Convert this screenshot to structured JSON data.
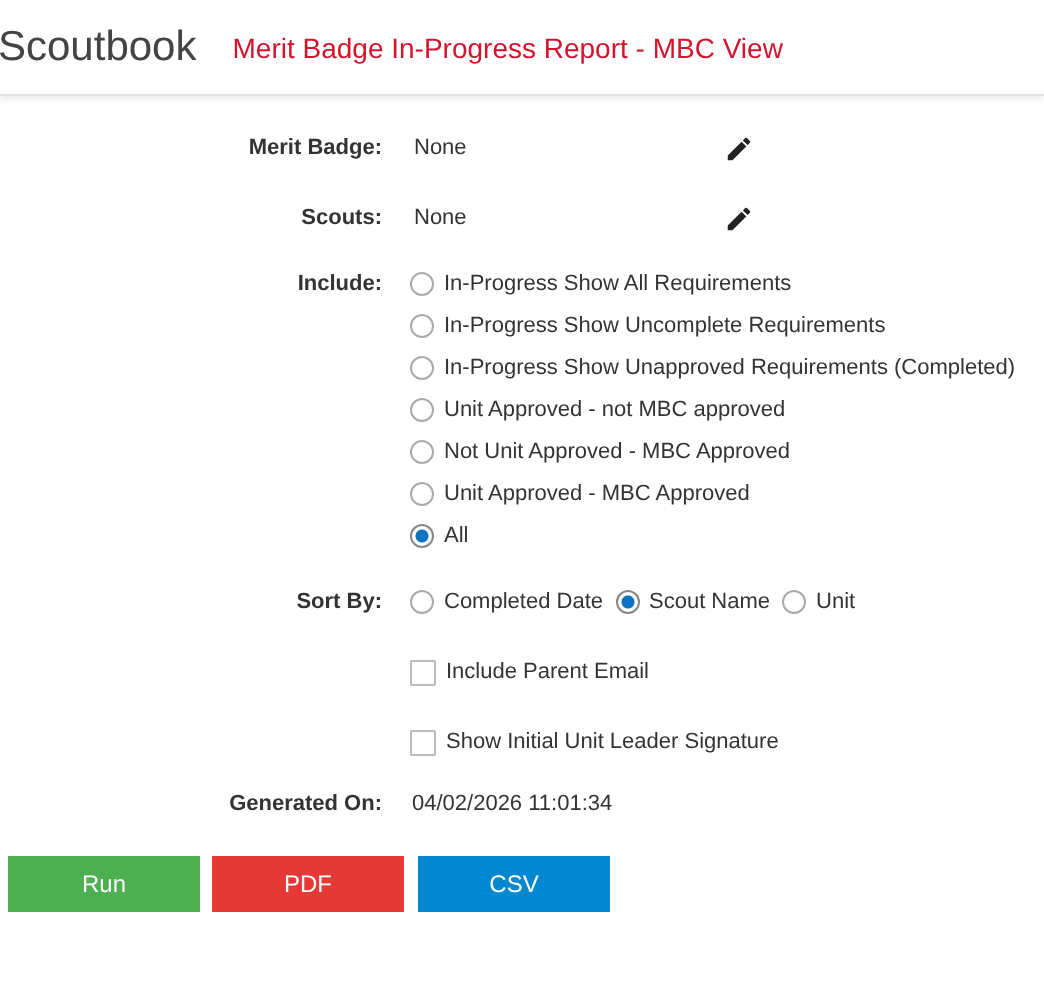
{
  "header": {
    "app_name": "Scoutbook",
    "page_title": "Merit Badge In-Progress Report - MBC View"
  },
  "merit_badge": {
    "label": "Merit Badge:",
    "value": "None"
  },
  "scouts": {
    "label": "Scouts:",
    "value": "None"
  },
  "include": {
    "label": "Include:",
    "options": [
      {
        "label": "In-Progress Show All Requirements",
        "selected": false
      },
      {
        "label": "In-Progress Show Uncomplete Requirements",
        "selected": false
      },
      {
        "label": "In-Progress Show Unapproved Requirements (Completed)",
        "selected": false
      },
      {
        "label": "Unit Approved - not MBC approved",
        "selected": false
      },
      {
        "label": "Not Unit Approved - MBC Approved",
        "selected": false
      },
      {
        "label": "Unit Approved - MBC Approved",
        "selected": false
      },
      {
        "label": "All",
        "selected": true
      }
    ]
  },
  "sort_by": {
    "label": "Sort By:",
    "options": [
      {
        "label": "Completed Date",
        "selected": false
      },
      {
        "label": "Scout Name",
        "selected": true
      },
      {
        "label": "Unit",
        "selected": false
      }
    ]
  },
  "checkboxes": [
    {
      "label": "Include Parent Email",
      "checked": false
    },
    {
      "label": "Show Initial Unit Leader Signature",
      "checked": false
    }
  ],
  "generated_on": {
    "label": "Generated On:",
    "value": "04/02/2026 11:01:34"
  },
  "buttons": [
    {
      "label": "Run",
      "color": "#4caf50"
    },
    {
      "label": "PDF",
      "color": "#e53935"
    },
    {
      "label": "CSV",
      "color": "#0288d1"
    }
  ]
}
